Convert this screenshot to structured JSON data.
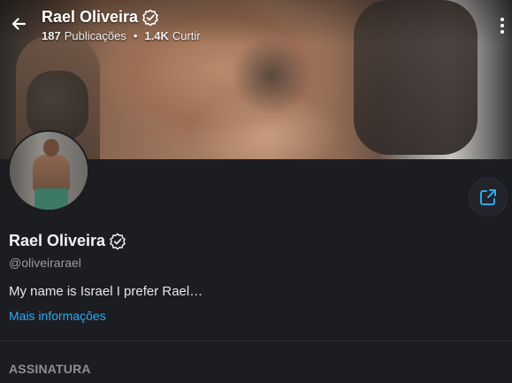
{
  "header": {
    "title": "Rael Oliveira",
    "posts_count": "187",
    "posts_label": "Publicações",
    "separator": "•",
    "likes_count": "1.4K",
    "likes_label": "Curtir"
  },
  "profile": {
    "name": "Rael Oliveira",
    "handle": "@oliveirarael",
    "bio": "My name is Israel I prefer Rael…",
    "more_info_label": "Mais informações"
  },
  "section": {
    "subscription_label": "ASSINATURA"
  },
  "icons": {
    "back": "arrow-left-icon",
    "menu": "more-vertical-icon",
    "share": "share-icon",
    "verified": "verified-badge-icon"
  },
  "colors": {
    "background": "#1c1d21",
    "accent": "#30a8f0",
    "muted_text": "#9a9ba2"
  }
}
